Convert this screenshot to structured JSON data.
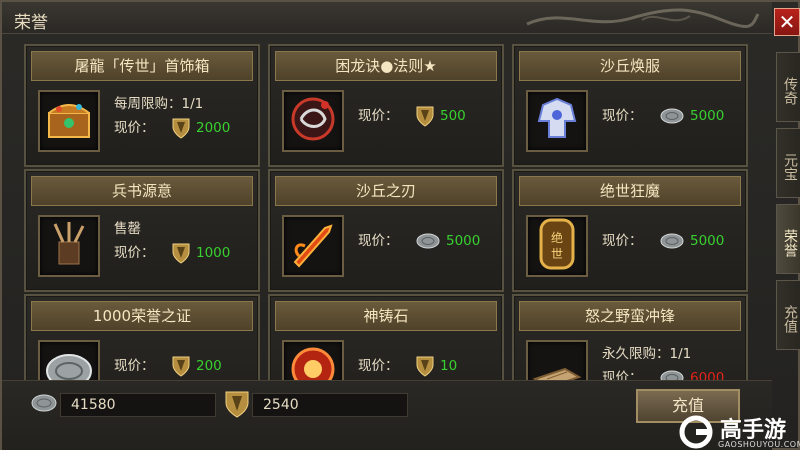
{
  "window": {
    "title": "荣誉",
    "close_label": "✕"
  },
  "tabs": [
    {
      "label": "传奇",
      "active": false
    },
    {
      "label": "元宝",
      "active": false
    },
    {
      "label": "荣誉",
      "active": true
    },
    {
      "label": "充值",
      "active": false
    }
  ],
  "items": [
    {
      "name": "屠龍「传世」首饰箱",
      "limit": "每周限购：1/1",
      "price_label": "现价：",
      "currency": "honor",
      "price": "2000",
      "icon": "treasure-chest-icon"
    },
    {
      "name": "困龙诀●法则★",
      "limit": "",
      "price_label": "现价：",
      "currency": "honor",
      "price": "500",
      "icon": "dragon-rune-icon"
    },
    {
      "name": "沙丘焕服",
      "limit": "",
      "price_label": "现价：",
      "currency": "silver",
      "price": "5000",
      "icon": "outfit-icon"
    },
    {
      "name": "兵书源意",
      "limit": "售罄",
      "price_label": "现价：",
      "currency": "honor",
      "price": "1000",
      "icon": "brush-holder-icon"
    },
    {
      "name": "沙丘之刃",
      "limit": "",
      "price_label": "现价：",
      "currency": "silver",
      "price": "5000",
      "icon": "flame-blade-icon"
    },
    {
      "name": "绝世狂魔",
      "limit": "",
      "price_label": "现价：",
      "currency": "silver",
      "price": "5000",
      "icon": "seal-plaque-icon",
      "icon_text": "绝世"
    },
    {
      "name": "1000荣誉之证",
      "limit": "",
      "price_label": "现价：",
      "currency": "honor",
      "price": "200",
      "icon": "silver-token-icon"
    },
    {
      "name": "神铸石",
      "limit": "",
      "price_label": "现价：",
      "currency": "honor",
      "price": "10",
      "icon": "forge-stone-icon"
    },
    {
      "name": "怒之野蛮冲锋",
      "limit": "永久限购：1/1",
      "price_label": "现价：",
      "currency": "silver",
      "price": "6000",
      "icon": "skill-book-icon"
    }
  ],
  "balances": {
    "silver": "41580",
    "honor": "2540"
  },
  "recharge_label": "充值",
  "watermark": {
    "brand": "高手游",
    "site": "GAOSHOUYOU.COM"
  },
  "colors": {
    "price_green": "#38d02f",
    "price_red": "#e0241a",
    "close_red": "#b9221b"
  }
}
